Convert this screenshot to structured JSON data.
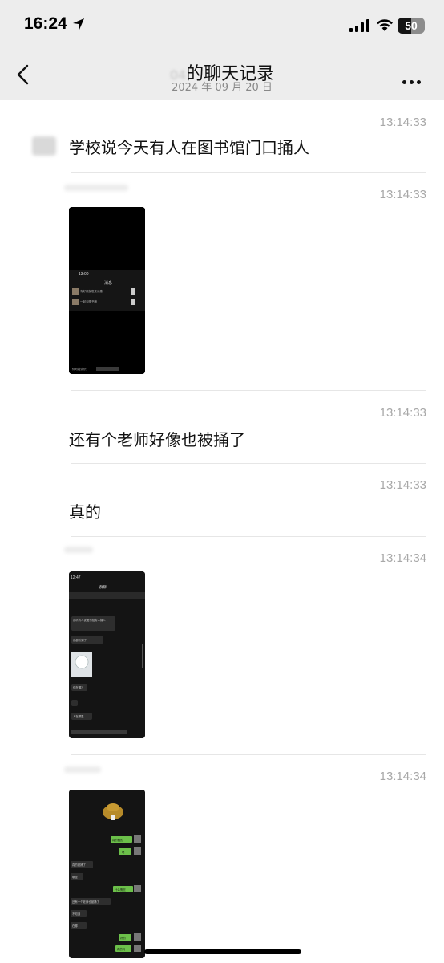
{
  "status_bar": {
    "time": "16:24",
    "battery": "50"
  },
  "nav": {
    "title_prefix": "04",
    "title": "的聊天记录",
    "date": "2024 年 09 月 20 日"
  },
  "messages": [
    {
      "type": "text",
      "time": "13:14:33",
      "text": "学校说今天有人在图书馆门口捅人"
    },
    {
      "type": "image",
      "time": "13:14:33",
      "image": {
        "top_time": "13:00",
        "top_title": "消息",
        "rows": [
          "有好朋友发来消息",
          "一起去图书馆"
        ],
        "caption": "你可能认识"
      }
    },
    {
      "type": "text",
      "time": "13:14:33",
      "text": "还有个老师好像也被捅了"
    },
    {
      "type": "text",
      "time": "13:14:33",
      "text": "真的"
    },
    {
      "type": "image",
      "time": "13:14:34",
      "image": {
        "top_time": "12:47",
        "top_title": "群聊",
        "rows": [
          "我听有人说图书馆有人捅人",
          "我都听到了",
          "你在哪?",
          "人在哪里"
        ]
      }
    },
    {
      "type": "image",
      "time": "13:14:34",
      "image": {
        "bubbles": [
          "真的假的",
          "嗯",
          "真的被捅了",
          "哪里",
          "什么情况",
          "还有一个老师也被捅了",
          "不知道",
          "在哪",
          "好的",
          "真的吗"
        ]
      }
    }
  ]
}
